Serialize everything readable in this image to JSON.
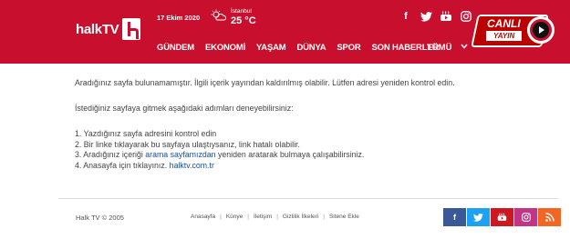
{
  "header": {
    "logo_text": "halkTV",
    "date": "17 Ekim 2020",
    "weather": {
      "city": "İstanbul",
      "temp": "25 °C"
    },
    "social": [
      {
        "name": "facebook-icon",
        "glyph": "f"
      },
      {
        "name": "twitter-icon",
        "glyph": "🐦"
      },
      {
        "name": "youtube-icon",
        "glyph": "▶"
      },
      {
        "name": "instagram-icon",
        "glyph": "◎"
      }
    ],
    "nav": [
      "GÜNDEM",
      "EKONOMİ",
      "YAŞAM",
      "DÜNYA",
      "SPOR",
      "SON HABERLER"
    ],
    "nav_all": "TÜMÜ",
    "live": {
      "line1": "CANLI",
      "line2": "YAYIN"
    }
  },
  "content": {
    "message": "Aradığınız sayfa bulunamamıştır. İlgili içerik yayından kaldırılmış olabilir. Lütfen adresi yeniden kontrol edin.",
    "tips_title": "İstediğiniz sayfaya gitmek aşağıdaki adımları deneyebilirsiniz:",
    "tip1": "1. Yazdığınız sayfa adresini kontrol edin",
    "tip2": "2. Bir linke tıklayarak bu sayfaya ulaştıysanız, link hatalı olabilir.",
    "tip3_pre": "3. Aradığınız içeriği ",
    "tip3_link": "arama sayfamızdan",
    "tip3_post": " yeniden aratarak bulmaya çalışabilirsiniz.",
    "tip4_pre": "4. Anasayfa için tıklayınız. ",
    "tip4_link": "halktv.com.tr"
  },
  "footer": {
    "copyright": "Halk TV © 2005",
    "links": [
      "Anasayfa",
      "Künye",
      "İletişim",
      "Gizlilik İlkeleri",
      "Sitene Ekle"
    ],
    "social": [
      {
        "name": "facebook-icon",
        "glyph": "f",
        "color": "#3b5998"
      },
      {
        "name": "twitter-icon",
        "glyph": "t",
        "color": "#1da1f2"
      },
      {
        "name": "youtube-icon",
        "glyph": "▶",
        "color": "#cc181e"
      },
      {
        "name": "instagram-icon",
        "glyph": "◎",
        "color": "#c13584"
      },
      {
        "name": "rss-icon",
        "glyph": "◉",
        "color": "#f26522"
      }
    ]
  },
  "colors": {
    "brand": "#c8102e",
    "link": "#1a4fa3"
  }
}
